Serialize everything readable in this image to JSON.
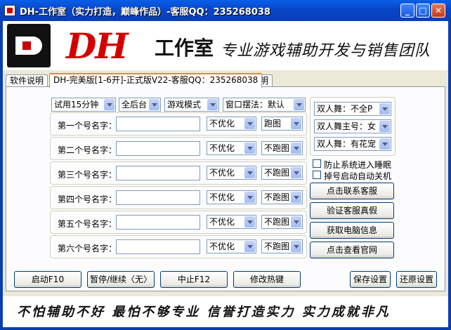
{
  "window": {
    "title": "DH-工作室（实力打造，巅峰作品）-客服QQ：235268038",
    "buttons": [
      "_",
      "□",
      "✕"
    ]
  },
  "banner": {
    "logo_text": "DH",
    "studio": "工作室",
    "slogan": "专业游戏辅助开发与销售团队"
  },
  "tabs": [
    {
      "label": "软件说明"
    },
    {
      "label": "DH-完美版[1-6开]-正式版V22-客服QQ：235268038"
    },
    {
      "label": "声明"
    }
  ],
  "top_selects": [
    "试用15分钟",
    "全后台",
    "游戏模式",
    "窗口摆法：默认"
  ],
  "accounts": [
    {
      "label": "第一个号名字：",
      "value": "",
      "opt": "不优化",
      "run": "跑图"
    },
    {
      "label": "第二个号名字：",
      "value": "",
      "opt": "不优化",
      "run": "不跑图"
    },
    {
      "label": "第三个号名字：",
      "value": "",
      "opt": "不优化",
      "run": "不跑图"
    },
    {
      "label": "第四个号名字：",
      "value": "",
      "opt": "不优化",
      "run": "不跑图"
    },
    {
      "label": "第五个号名字：",
      "value": "",
      "opt": "不优化",
      "run": "不跑图"
    },
    {
      "label": "第六个号名字：",
      "value": "",
      "opt": "不优化",
      "run": "不跑图"
    }
  ],
  "dance_selects": [
    "双人舞：不全P",
    "双人舞主号：女",
    "双人舞：有花宠"
  ],
  "checkboxes": [
    {
      "label": "防止系统进入睡眠",
      "checked": false
    },
    {
      "label": "掉号启动自动关机",
      "checked": false
    }
  ],
  "side_buttons": [
    "点击联系客服",
    "验证客服真假",
    "获取电脑信息",
    "点击查看官网"
  ],
  "bottom_buttons": [
    "启动F10",
    "暂停/继续〈无〉",
    "中止F12",
    "修改热键",
    "保存设置",
    "还原设置"
  ],
  "footer": {
    "text": "不怕辅助不好 最怕不够专业 信誉打造实力 实力成就非凡"
  },
  "colors": {
    "title_bar": "#0a3fb0",
    "brand_red": "#d40000",
    "client_bg": "#ece9d8"
  }
}
